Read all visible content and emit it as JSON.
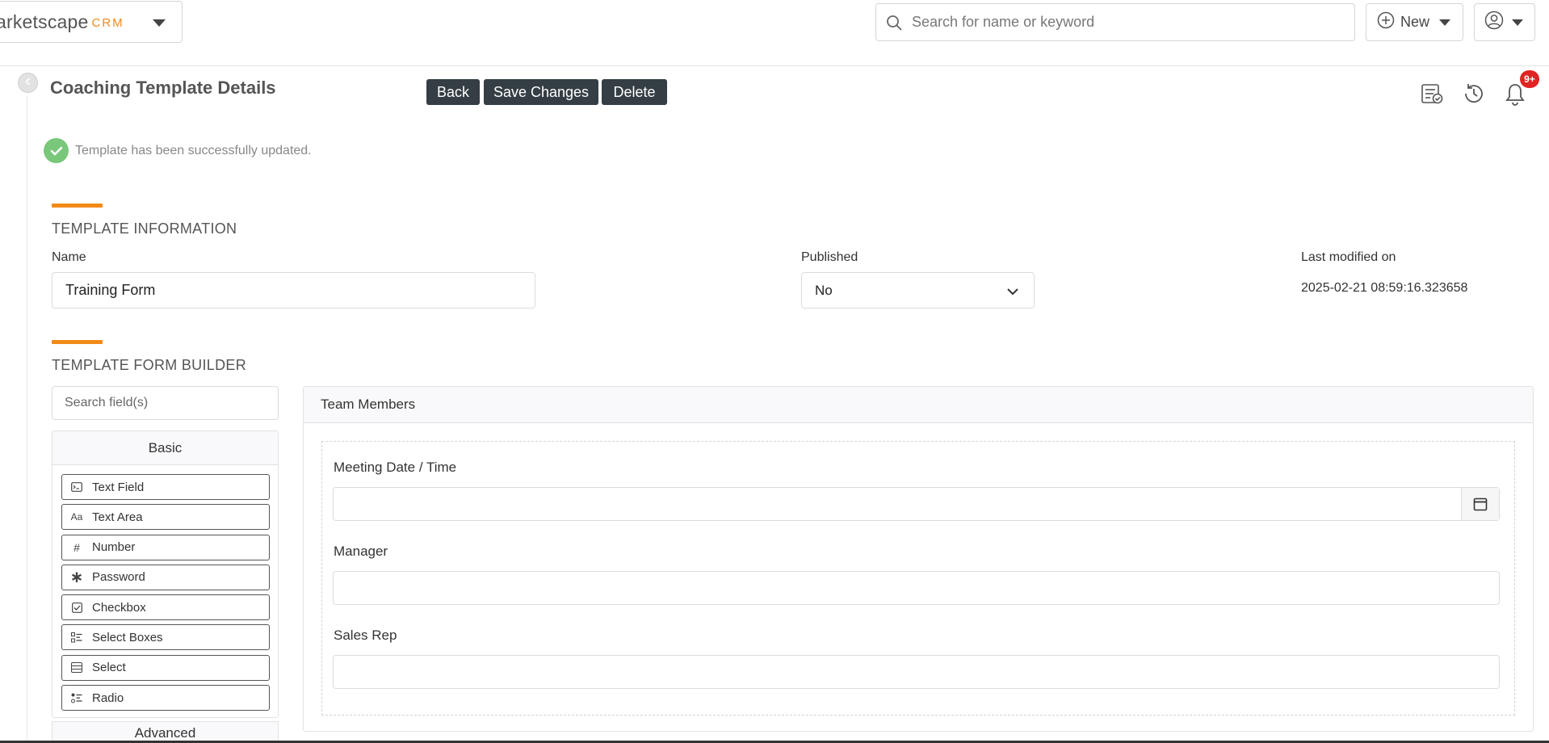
{
  "brand": {
    "main": "arketscape",
    "crm": "CRM"
  },
  "search": {
    "placeholder": "Search for name or keyword"
  },
  "topbar": {
    "new_label": "New"
  },
  "page": {
    "title": "Coaching Template Details",
    "buttons": {
      "back": "Back",
      "save": "Save Changes",
      "delete": "Delete"
    },
    "notification_badge": "9+"
  },
  "alert": {
    "message": "Template has been successfully updated."
  },
  "template_info": {
    "section_title": "TEMPLATE INFORMATION",
    "name_label": "Name",
    "name_value": "Training Form",
    "published_label": "Published",
    "published_value": "No",
    "modified_label": "Last modified on",
    "modified_value": "2025-02-21 08:59:16.323658"
  },
  "builder": {
    "section_title": "TEMPLATE FORM BUILDER",
    "search_placeholder": "Search field(s)",
    "basic_title": "Basic",
    "components": [
      {
        "label": "Text Field",
        "icon": "terminal-icon"
      },
      {
        "label": "Text Area",
        "icon": "font-icon"
      },
      {
        "label": "Number",
        "icon": "hashtag-icon"
      },
      {
        "label": "Password",
        "icon": "asterisk-icon"
      },
      {
        "label": "Checkbox",
        "icon": "checkbox-icon"
      },
      {
        "label": "Select Boxes",
        "icon": "list-checks-icon"
      },
      {
        "label": "Select",
        "icon": "list-icon"
      },
      {
        "label": "Radio",
        "icon": "radio-list-icon"
      }
    ],
    "advanced_title": "Advanced",
    "canvas_title": "Team Members",
    "fields": [
      {
        "label": "Meeting Date / Time"
      },
      {
        "label": "Manager"
      },
      {
        "label": "Sales Rep"
      }
    ]
  },
  "colors": {
    "accent": "#f28a1a",
    "button_dark": "#343e44",
    "success": "#79c77b",
    "badge": "#e02424"
  }
}
